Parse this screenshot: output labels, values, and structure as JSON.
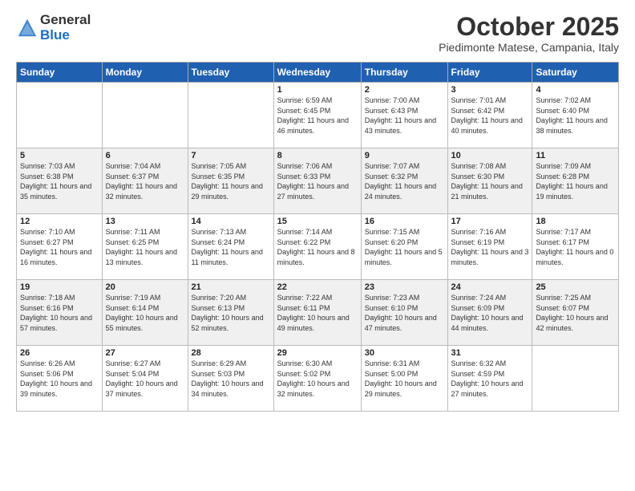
{
  "header": {
    "logo_general": "General",
    "logo_blue": "Blue",
    "month_title": "October 2025",
    "location": "Piedimonte Matese, Campania, Italy"
  },
  "days_of_week": [
    "Sunday",
    "Monday",
    "Tuesday",
    "Wednesday",
    "Thursday",
    "Friday",
    "Saturday"
  ],
  "weeks": [
    [
      {
        "day": "",
        "info": ""
      },
      {
        "day": "",
        "info": ""
      },
      {
        "day": "",
        "info": ""
      },
      {
        "day": "1",
        "info": "Sunrise: 6:59 AM\nSunset: 6:45 PM\nDaylight: 11 hours and 46 minutes."
      },
      {
        "day": "2",
        "info": "Sunrise: 7:00 AM\nSunset: 6:43 PM\nDaylight: 11 hours and 43 minutes."
      },
      {
        "day": "3",
        "info": "Sunrise: 7:01 AM\nSunset: 6:42 PM\nDaylight: 11 hours and 40 minutes."
      },
      {
        "day": "4",
        "info": "Sunrise: 7:02 AM\nSunset: 6:40 PM\nDaylight: 11 hours and 38 minutes."
      }
    ],
    [
      {
        "day": "5",
        "info": "Sunrise: 7:03 AM\nSunset: 6:38 PM\nDaylight: 11 hours and 35 minutes."
      },
      {
        "day": "6",
        "info": "Sunrise: 7:04 AM\nSunset: 6:37 PM\nDaylight: 11 hours and 32 minutes."
      },
      {
        "day": "7",
        "info": "Sunrise: 7:05 AM\nSunset: 6:35 PM\nDaylight: 11 hours and 29 minutes."
      },
      {
        "day": "8",
        "info": "Sunrise: 7:06 AM\nSunset: 6:33 PM\nDaylight: 11 hours and 27 minutes."
      },
      {
        "day": "9",
        "info": "Sunrise: 7:07 AM\nSunset: 6:32 PM\nDaylight: 11 hours and 24 minutes."
      },
      {
        "day": "10",
        "info": "Sunrise: 7:08 AM\nSunset: 6:30 PM\nDaylight: 11 hours and 21 minutes."
      },
      {
        "day": "11",
        "info": "Sunrise: 7:09 AM\nSunset: 6:28 PM\nDaylight: 11 hours and 19 minutes."
      }
    ],
    [
      {
        "day": "12",
        "info": "Sunrise: 7:10 AM\nSunset: 6:27 PM\nDaylight: 11 hours and 16 minutes."
      },
      {
        "day": "13",
        "info": "Sunrise: 7:11 AM\nSunset: 6:25 PM\nDaylight: 11 hours and 13 minutes."
      },
      {
        "day": "14",
        "info": "Sunrise: 7:13 AM\nSunset: 6:24 PM\nDaylight: 11 hours and 11 minutes."
      },
      {
        "day": "15",
        "info": "Sunrise: 7:14 AM\nSunset: 6:22 PM\nDaylight: 11 hours and 8 minutes."
      },
      {
        "day": "16",
        "info": "Sunrise: 7:15 AM\nSunset: 6:20 PM\nDaylight: 11 hours and 5 minutes."
      },
      {
        "day": "17",
        "info": "Sunrise: 7:16 AM\nSunset: 6:19 PM\nDaylight: 11 hours and 3 minutes."
      },
      {
        "day": "18",
        "info": "Sunrise: 7:17 AM\nSunset: 6:17 PM\nDaylight: 11 hours and 0 minutes."
      }
    ],
    [
      {
        "day": "19",
        "info": "Sunrise: 7:18 AM\nSunset: 6:16 PM\nDaylight: 10 hours and 57 minutes."
      },
      {
        "day": "20",
        "info": "Sunrise: 7:19 AM\nSunset: 6:14 PM\nDaylight: 10 hours and 55 minutes."
      },
      {
        "day": "21",
        "info": "Sunrise: 7:20 AM\nSunset: 6:13 PM\nDaylight: 10 hours and 52 minutes."
      },
      {
        "day": "22",
        "info": "Sunrise: 7:22 AM\nSunset: 6:11 PM\nDaylight: 10 hours and 49 minutes."
      },
      {
        "day": "23",
        "info": "Sunrise: 7:23 AM\nSunset: 6:10 PM\nDaylight: 10 hours and 47 minutes."
      },
      {
        "day": "24",
        "info": "Sunrise: 7:24 AM\nSunset: 6:09 PM\nDaylight: 10 hours and 44 minutes."
      },
      {
        "day": "25",
        "info": "Sunrise: 7:25 AM\nSunset: 6:07 PM\nDaylight: 10 hours and 42 minutes."
      }
    ],
    [
      {
        "day": "26",
        "info": "Sunrise: 6:26 AM\nSunset: 5:06 PM\nDaylight: 10 hours and 39 minutes."
      },
      {
        "day": "27",
        "info": "Sunrise: 6:27 AM\nSunset: 5:04 PM\nDaylight: 10 hours and 37 minutes."
      },
      {
        "day": "28",
        "info": "Sunrise: 6:29 AM\nSunset: 5:03 PM\nDaylight: 10 hours and 34 minutes."
      },
      {
        "day": "29",
        "info": "Sunrise: 6:30 AM\nSunset: 5:02 PM\nDaylight: 10 hours and 32 minutes."
      },
      {
        "day": "30",
        "info": "Sunrise: 6:31 AM\nSunset: 5:00 PM\nDaylight: 10 hours and 29 minutes."
      },
      {
        "day": "31",
        "info": "Sunrise: 6:32 AM\nSunset: 4:59 PM\nDaylight: 10 hours and 27 minutes."
      },
      {
        "day": "",
        "info": ""
      }
    ]
  ]
}
